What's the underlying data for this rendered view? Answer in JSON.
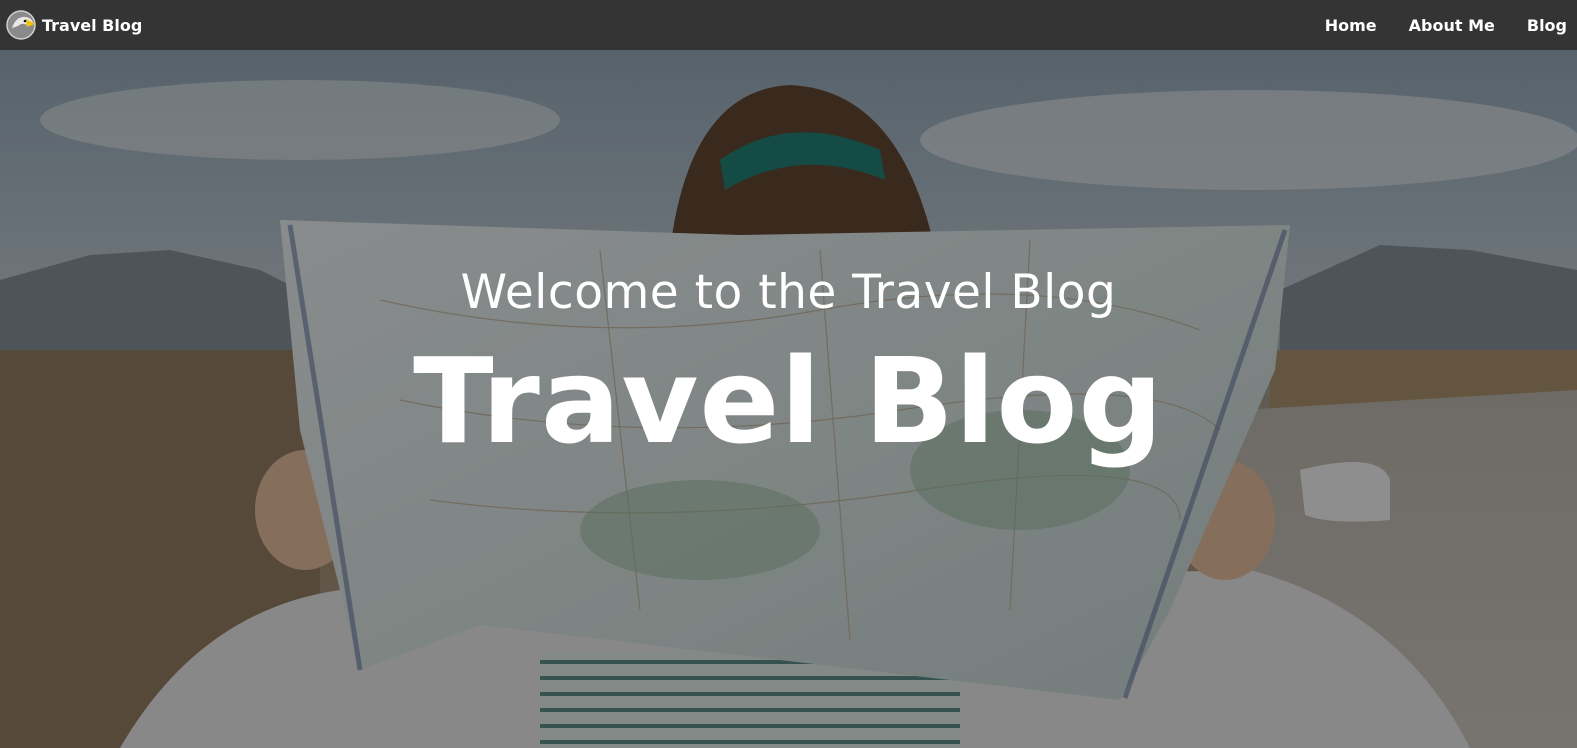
{
  "nav": {
    "brand": "Travel Blog",
    "links": [
      {
        "label": "Home"
      },
      {
        "label": "About Me"
      },
      {
        "label": "Blog"
      }
    ]
  },
  "hero": {
    "subtitle": "Welcome to the Travel Blog",
    "title": "Travel Blog"
  },
  "colors": {
    "navbar": "#343434",
    "text": "#ffffff",
    "overlay": "rgba(20,20,20,0.45)",
    "headband": "#1b8a7a"
  }
}
